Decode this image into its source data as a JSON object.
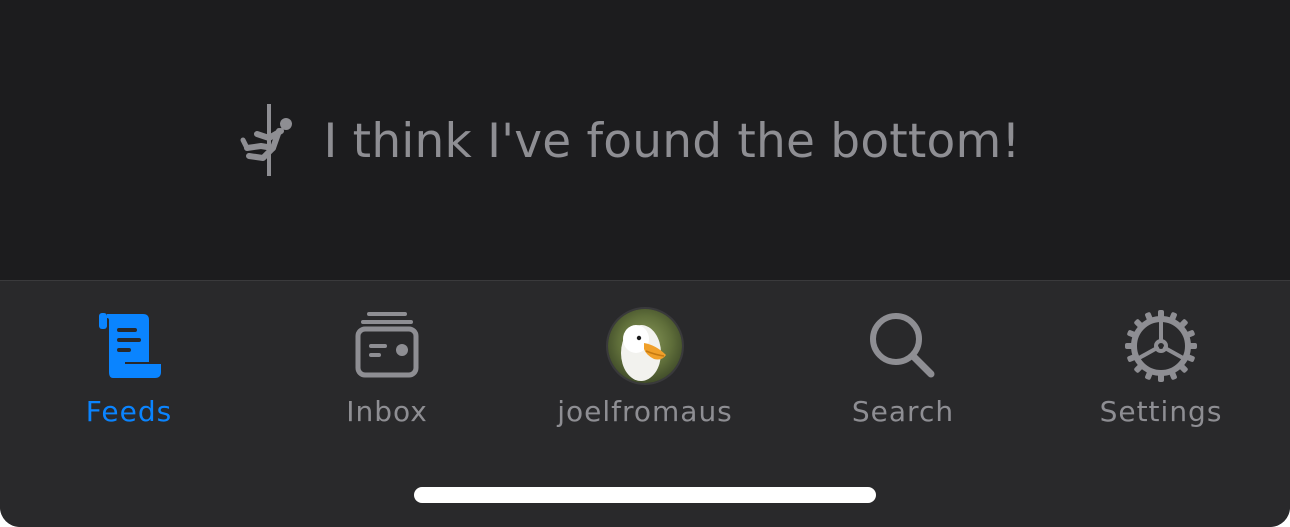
{
  "end_message": {
    "icon": "pole-climber-icon",
    "text": "I think I've found the bottom!"
  },
  "tab_bar": {
    "tabs": [
      {
        "label": "Feeds",
        "icon": "scroll-feed-icon",
        "active": true
      },
      {
        "label": "Inbox",
        "icon": "inbox-stack-icon",
        "active": false
      },
      {
        "label": "joelfromaus",
        "icon": "avatar-duck",
        "active": false
      },
      {
        "label": "Search",
        "icon": "magnifier-icon",
        "active": false
      },
      {
        "label": "Settings",
        "icon": "gear-icon",
        "active": false
      }
    ]
  },
  "colors": {
    "background": "#1c1c1e",
    "tab_bar_background": "#29292b",
    "accent": "#0a84ff",
    "inactive": "#8e8e93",
    "home_indicator": "#ffffff"
  }
}
